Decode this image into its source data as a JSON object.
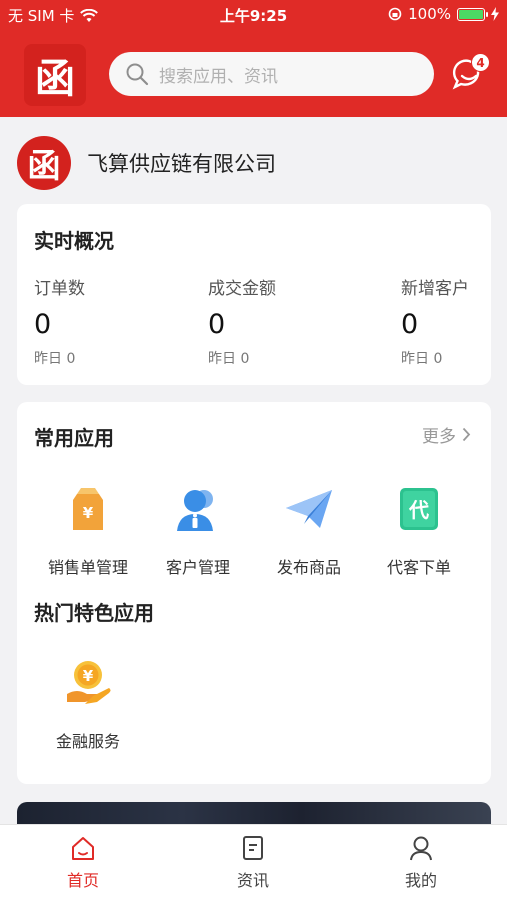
{
  "status_bar": {
    "carrier": "无 SIM 卡",
    "time": "上午9:25",
    "battery_percent": "100%",
    "battery_level": 1.0
  },
  "header": {
    "logo_text": "函",
    "search_placeholder": "搜索应用、资讯",
    "message_badge": "4"
  },
  "company": {
    "avatar_text": "函",
    "name": "飞算供应链有限公司"
  },
  "overview": {
    "title": "实时概况",
    "stats": [
      {
        "label": "订单数",
        "value": "0",
        "yesterday": "昨日 0"
      },
      {
        "label": "成交金额",
        "value": "0",
        "yesterday": "昨日 0"
      },
      {
        "label": "新增客户",
        "value": "0",
        "yesterday": "昨日 0"
      }
    ]
  },
  "common_apps": {
    "title": "常用应用",
    "more": "更多",
    "items": [
      {
        "label": "销售单管理",
        "icon": "sales-order-icon"
      },
      {
        "label": "客户管理",
        "icon": "customer-icon"
      },
      {
        "label": "发布商品",
        "icon": "paper-plane-icon"
      },
      {
        "label": "代客下单",
        "icon": "proxy-order-icon",
        "glyph": "代"
      }
    ]
  },
  "hot_apps": {
    "title": "热门特色应用",
    "items": [
      {
        "label": "金融服务",
        "icon": "finance-icon",
        "glyph": "¥"
      }
    ]
  },
  "tabbar": {
    "items": [
      {
        "label": "首页",
        "icon": "home-icon",
        "active": true
      },
      {
        "label": "资讯",
        "icon": "news-icon",
        "active": false
      },
      {
        "label": "我的",
        "icon": "profile-icon",
        "active": false
      }
    ]
  },
  "colors": {
    "brand_red": "#e02b27",
    "orange": "#f5a623",
    "blue": "#3a8ee6",
    "green": "#2cc28f"
  }
}
